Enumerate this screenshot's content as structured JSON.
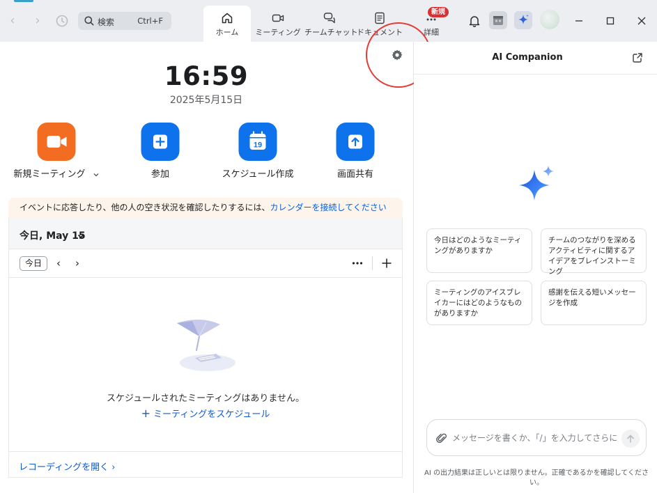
{
  "search": {
    "label": "検索",
    "shortcut": "Ctrl+F"
  },
  "tabs": [
    {
      "label": "ホーム",
      "icon": "home-icon",
      "active": true
    },
    {
      "label": "ミーティング",
      "icon": "video-icon",
      "active": false
    },
    {
      "label": "チームチャット",
      "icon": "chat-icon",
      "active": false
    },
    {
      "label": "ドキュメント",
      "icon": "document-icon",
      "active": false
    },
    {
      "label": "詳細",
      "icon": "more-icon",
      "active": false,
      "badge": "新規"
    }
  ],
  "home": {
    "time": "16:59",
    "date": "2025年5月15日",
    "actions": [
      {
        "label": "新規ミーティング",
        "icon": "video-camera-icon",
        "color": "#f26d21",
        "has_dropdown": true
      },
      {
        "label": "参加",
        "icon": "plus-icon",
        "color": "#0e72ed"
      },
      {
        "label": "スケジュール作成",
        "icon": "calendar-icon",
        "color": "#0e72ed",
        "day": "19"
      },
      {
        "label": "画面共有",
        "icon": "upload-arrow-icon",
        "color": "#0e72ed"
      }
    ]
  },
  "banner": {
    "text": "イベントに応答したり、他の人の空き状況を確認したりするには、",
    "link": "カレンダーを接続してください"
  },
  "calendar": {
    "title": "今日, May 15",
    "today_button": "今日",
    "prev": "‹",
    "next": "›",
    "empty_message": "スケジュールされたミーティングはありません。",
    "schedule_link": "ミーティングをスケジュール",
    "footer_link": "レコーディングを開く ›"
  },
  "ai": {
    "title": "AI Companion",
    "suggestions": [
      "今日はどのようなミーティングがありますか",
      "チームのつながりを深めるアクティビティに関するアイデアをブレインストーミング",
      "ミーティングのアイスブレイカーにはどのようなものがありますか",
      "感謝を伝える短いメッセージを作成"
    ],
    "input_placeholder": "メッセージを書くか、「/」を入力してさらに機...",
    "disclaimer": "AI の出力結果は正しいとは限りません。正確であるかを確認してください。"
  },
  "colors": {
    "accent_blue": "#0e72ed",
    "accent_orange": "#f26d21",
    "link_blue": "#0b5cd7",
    "badge_red": "#d63233",
    "highlight_red": "#e53935"
  }
}
